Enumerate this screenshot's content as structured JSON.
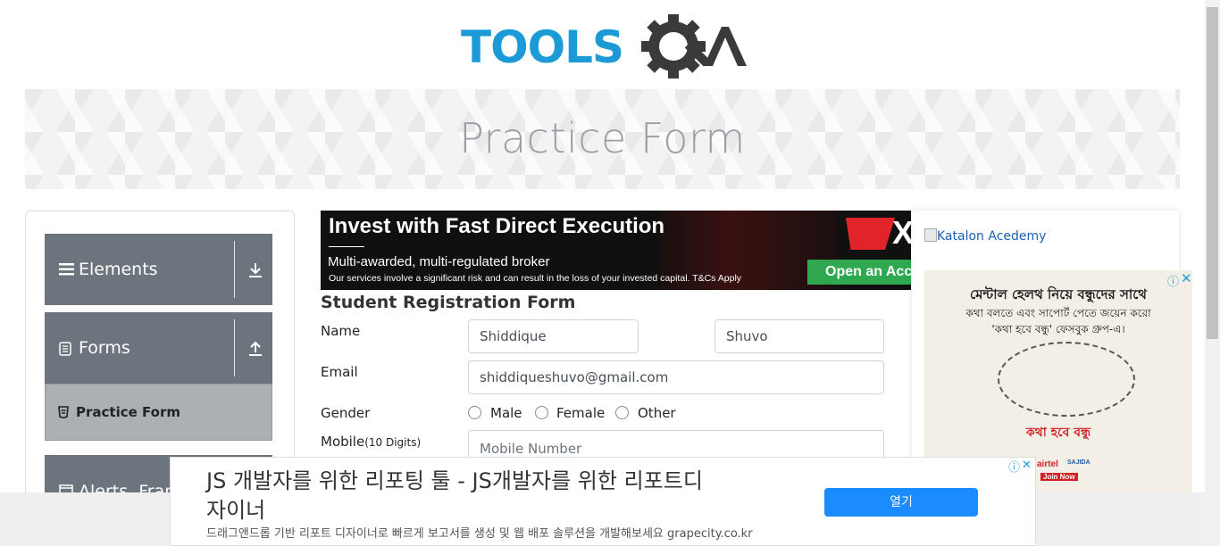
{
  "logo": {
    "text_a": "TOOLS",
    "text_b": "QA"
  },
  "banner": {
    "title": "Practice Form"
  },
  "sidebar": {
    "groups": [
      {
        "label": "Elements",
        "icon": "hamburger-icon",
        "arrow": "download-arrow-icon"
      },
      {
        "label": "Forms",
        "icon": "document-icon",
        "arrow": "upload-arrow-icon"
      },
      {
        "label": "Alerts, Fram",
        "icon": "window-icon"
      }
    ],
    "active_item": "Practice Form"
  },
  "ad_top": {
    "headline": "Invest with Fast Direct Execution",
    "subline": "Multi-awarded, multi-regulated broker",
    "disclaimer": "Our services involve a significant risk and can result in the loss of your invested capital. T&Cs Apply",
    "cta": "Open an Acc",
    "brand_letter": "X",
    "colors": {
      "bg": "#101010",
      "cta": "#2fa84f",
      "brand": "#e0242a"
    }
  },
  "form": {
    "heading": "Student Registration Form",
    "name_label": "Name",
    "first_name": "Shiddique",
    "last_name": "Shuvo",
    "email_label": "Email",
    "email_value": "shiddiqueshuvo@gmail.com",
    "gender_label": "Gender",
    "gender_options": [
      "Male",
      "Female",
      "Other"
    ],
    "mobile_label": "Mobile",
    "mobile_hint": "(10 Digits)",
    "mobile_placeholder": "Mobile Number"
  },
  "right": {
    "image_alt": "Katalon Acedemy",
    "ad_bengali_line1": "মেন্টাল হেলথ নিয়ে বন্ধুদের সাথে",
    "ad_bengali_line2": "কথা বলতে এবং সাপোর্ট পেতে জয়েন করো",
    "ad_bengali_line3": "'কথা হবে বন্ধু' ফেসবুক গ্রুপ-এ।",
    "ad_brand": "কথা হবে বন্ধু",
    "ad_partner_1": "airtel",
    "ad_partner_2": "SAJIDA",
    "ad_join": "Join Now"
  },
  "ad_bottom": {
    "title": "JS 개발자를 위한 리포팅 툴 - JS개발자를 위한 리포트디자이너",
    "description": "드래그앤드롭 기반 리포트 디자이너로 빠르게 보고서를 생성 및 웹 배포 솔루션을 개발해보세요 grapecity.co.kr",
    "button": "열기",
    "colors": {
      "button": "#1a8cff"
    }
  }
}
